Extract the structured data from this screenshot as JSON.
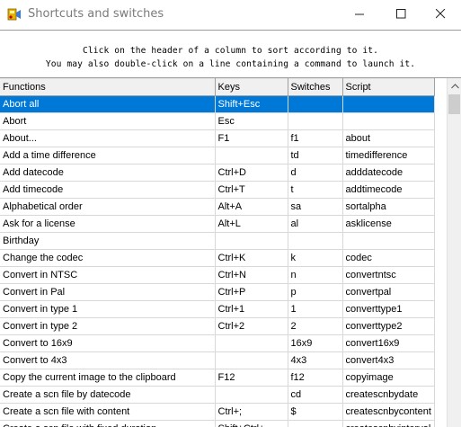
{
  "window": {
    "title": "Shortcuts and switches"
  },
  "instructions": {
    "line1": "Click on the header of a column to sort according to it.",
    "line2": "You may also double-click on a line containing a command to launch it."
  },
  "table": {
    "columns": [
      "Functions",
      "Keys",
      "Switches",
      "Script"
    ],
    "selected_row": 0,
    "rows": [
      [
        "Abort all",
        "Shift+Esc",
        "",
        ""
      ],
      [
        "Abort",
        "Esc",
        "",
        ""
      ],
      [
        "About...",
        "F1",
        "f1",
        "about"
      ],
      [
        "Add a time difference",
        "",
        "td",
        "timedifference"
      ],
      [
        "Add datecode",
        "Ctrl+D",
        "d",
        "adddatecode"
      ],
      [
        "Add timecode",
        "Ctrl+T",
        "t",
        "addtimecode"
      ],
      [
        "Alphabetical order",
        "Alt+A",
        "sa",
        "sortalpha"
      ],
      [
        "Ask for a license",
        "Alt+L",
        "al",
        "asklicense"
      ],
      [
        "Birthday",
        "",
        "",
        ""
      ],
      [
        "Change the codec",
        "Ctrl+K",
        "k",
        "codec"
      ],
      [
        "Convert in NTSC",
        "Ctrl+N",
        "n",
        "convertntsc"
      ],
      [
        "Convert in Pal",
        "Ctrl+P",
        "p",
        "convertpal"
      ],
      [
        "Convert in type 1",
        "Ctrl+1",
        "1",
        "converttype1"
      ],
      [
        "Convert in type 2",
        "Ctrl+2",
        "2",
        "converttype2"
      ],
      [
        "Convert to 16x9",
        "",
        "16x9",
        "convert16x9"
      ],
      [
        "Convert to 4x3",
        "",
        "4x3",
        "convert4x3"
      ],
      [
        "Copy the current image to the clipboard",
        "F12",
        "f12",
        "copyimage"
      ],
      [
        "Create a scn file by datecode",
        "",
        "cd",
        "createscnbydate"
      ],
      [
        "Create a scn file with content",
        "Ctrl+;",
        "$",
        "createscnbycontent"
      ],
      [
        "Create a scn file with fixed duration",
        "Shift+Ctrl+...",
        "...",
        "createscnbyinterval"
      ]
    ]
  },
  "colors": {
    "selection": "#0078d7",
    "header_bg": "#f0f0f0"
  }
}
